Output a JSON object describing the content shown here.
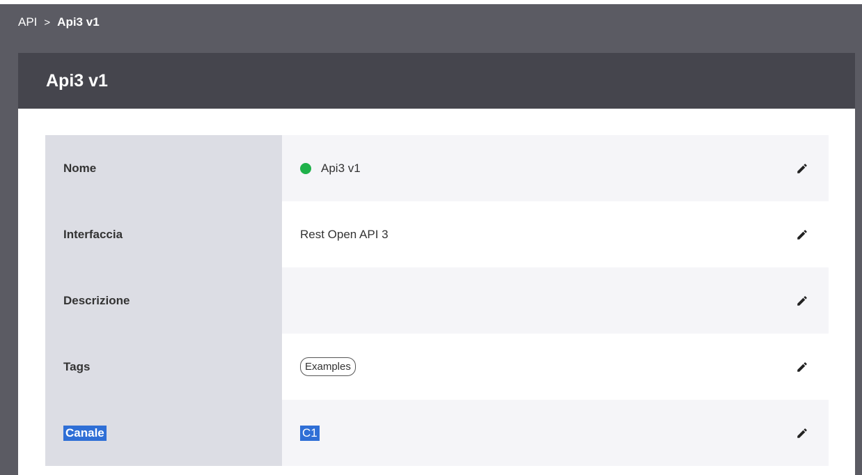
{
  "breadcrumb": {
    "root": "API",
    "separator": ">",
    "current": "Api3 v1"
  },
  "header": {
    "title": "Api3 v1"
  },
  "rows": [
    {
      "label": "Nome",
      "value": "Api3 v1",
      "status": "active"
    },
    {
      "label": "Interfaccia",
      "value": "Rest Open API 3"
    },
    {
      "label": "Descrizione",
      "value": ""
    },
    {
      "label": "Tags",
      "tag": "Examples"
    },
    {
      "label": "Canale",
      "value": "C1"
    }
  ],
  "colors": {
    "status_active": "#1fb14a",
    "selection": "#2f6fd6",
    "header_bg": "#45454d",
    "frame_bg": "#5b5b63"
  },
  "icons": {
    "edit": "pencil-icon"
  }
}
